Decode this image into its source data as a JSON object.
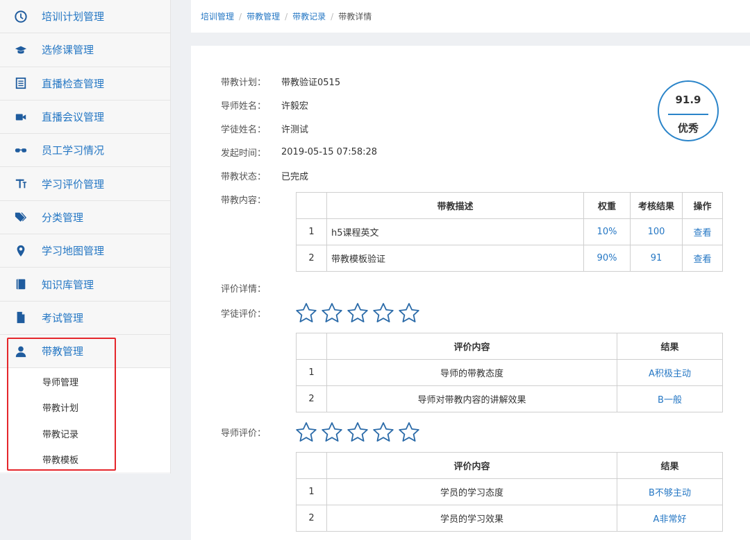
{
  "sidebar": {
    "items": [
      {
        "label": "培训计划管理",
        "icon": "clock-icon"
      },
      {
        "label": "选修课管理",
        "icon": "graduation-cap-icon"
      },
      {
        "label": "直播检查管理",
        "icon": "list-icon"
      },
      {
        "label": "直播会议管理",
        "icon": "video-camera-icon"
      },
      {
        "label": "员工学习情况",
        "icon": "glasses-icon"
      },
      {
        "label": "学习评价管理",
        "icon": "text-height-icon"
      },
      {
        "label": "分类管理",
        "icon": "tags-icon"
      },
      {
        "label": "学习地图管理",
        "icon": "map-marker-icon"
      },
      {
        "label": "知识库管理",
        "icon": "book-icon"
      },
      {
        "label": "考试管理",
        "icon": "file-icon"
      },
      {
        "label": "带教管理",
        "icon": "user-icon"
      }
    ],
    "sub_items": [
      "导师管理",
      "带教计划",
      "带教记录",
      "带教模板"
    ]
  },
  "breadcrumb": [
    "培训管理",
    "带教管理",
    "带教记录",
    "带教详情"
  ],
  "info": [
    {
      "label": "带教计划：",
      "value": "带教验证0515"
    },
    {
      "label": "导师姓名：",
      "value": "许毅宏"
    },
    {
      "label": "学徒姓名：",
      "value": "许测试"
    },
    {
      "label": "发起时间：",
      "value": "2019-05-15 07:58:28"
    },
    {
      "label": "带教状态：",
      "value": "已完成"
    }
  ],
  "score": {
    "value": "91.9",
    "grade": "优秀",
    "accent": "#2a84c9"
  },
  "content": {
    "label": "带教内容：",
    "headers": [
      "",
      "带教描述",
      "权重",
      "考核结果",
      "操作"
    ],
    "rows": [
      {
        "no": "1",
        "desc": "h5课程英文",
        "weight": "10%",
        "result": "100",
        "action": "查看"
      },
      {
        "no": "2",
        "desc": "带教模板验证",
        "weight": "90%",
        "result": "91",
        "action": "查看"
      }
    ]
  },
  "eval_detail_label": "评价详情：",
  "apprentice_eval": {
    "label": "学徒评价：",
    "stars": 0,
    "headers": [
      "",
      "评价内容",
      "结果"
    ],
    "rows": [
      {
        "no": "1",
        "content": "导师的带教态度",
        "result": "A积极主动"
      },
      {
        "no": "2",
        "content": "导师对带教内容的讲解效果",
        "result": "B一般"
      }
    ]
  },
  "mentor_eval": {
    "label": "导师评价：",
    "stars": 0,
    "headers": [
      "",
      "评价内容",
      "结果"
    ],
    "rows": [
      {
        "no": "1",
        "content": "学员的学习态度",
        "result": "B不够主动"
      },
      {
        "no": "2",
        "content": "学员的学习效果",
        "result": "A非常好"
      }
    ]
  }
}
